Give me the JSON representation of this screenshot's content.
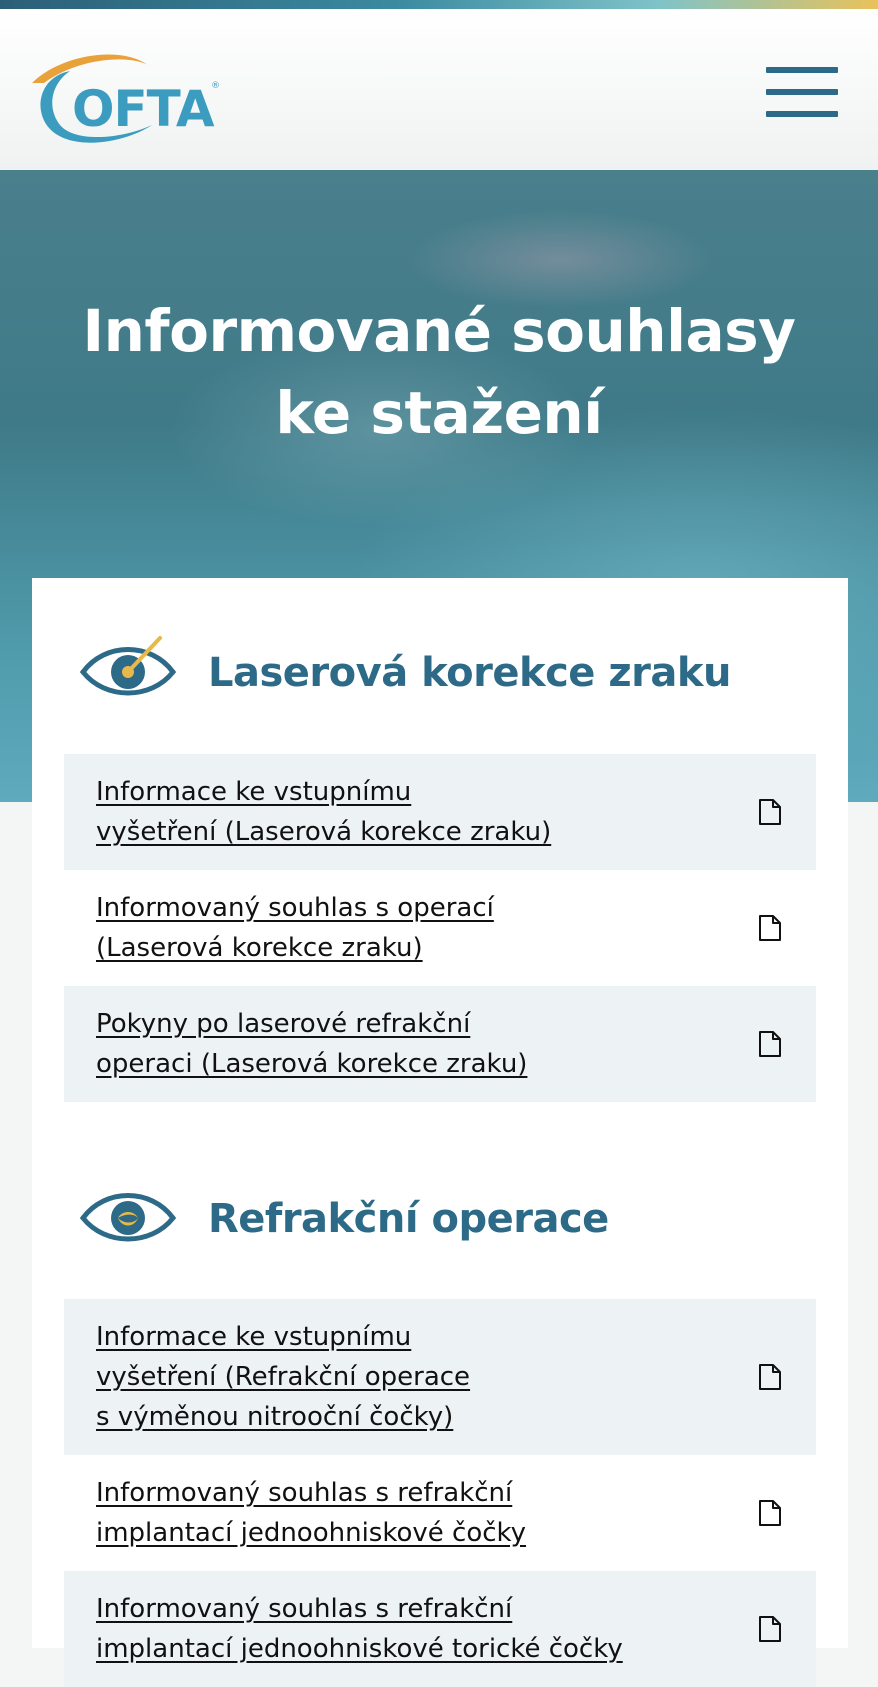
{
  "header": {
    "logo_text": "OFTA",
    "logo_mark": "®",
    "menu_icon": "hamburger-icon"
  },
  "hero": {
    "title_line1": "Informované souhlasy",
    "title_line2": "ke stažení"
  },
  "sections": [
    {
      "title": "Laserová korekce zraku",
      "icon": "eye-laser-icon",
      "documents": [
        {
          "line1": "Informace ke vstupnímu",
          "line2": "vyšetření (Laserová korekce zraku)",
          "icon": "document-icon"
        },
        {
          "line1": "Informovaný souhlas s operací",
          "line2": "(Laserová korekce zraku)",
          "icon": "document-icon"
        },
        {
          "line1": "Pokyny po laserové refrakční",
          "line2": "operaci (Laserová korekce zraku)",
          "icon": "document-icon"
        }
      ]
    },
    {
      "title": "Refrakční operace",
      "icon": "eye-lens-icon",
      "documents": [
        {
          "line1": "Informace ke vstupnímu",
          "line2": "vyšetření (Refrakční operace",
          "line3": "s výměnou nitrooční čočky)",
          "icon": "document-icon"
        },
        {
          "line1": "Informovaný souhlas s refrakční",
          "line2": "implantací jednoohniskové čočky",
          "icon": "document-icon"
        },
        {
          "line1": "Informovaný souhlas s refrakční",
          "line2": "implantací jednoohniskové torické čočky",
          "icon": "document-icon"
        }
      ]
    }
  ],
  "colors": {
    "brand_dark": "#2d6a88",
    "brand_light": "#3b9cbf",
    "accent": "#e9b84a",
    "row_alt": "#edf2f4"
  }
}
